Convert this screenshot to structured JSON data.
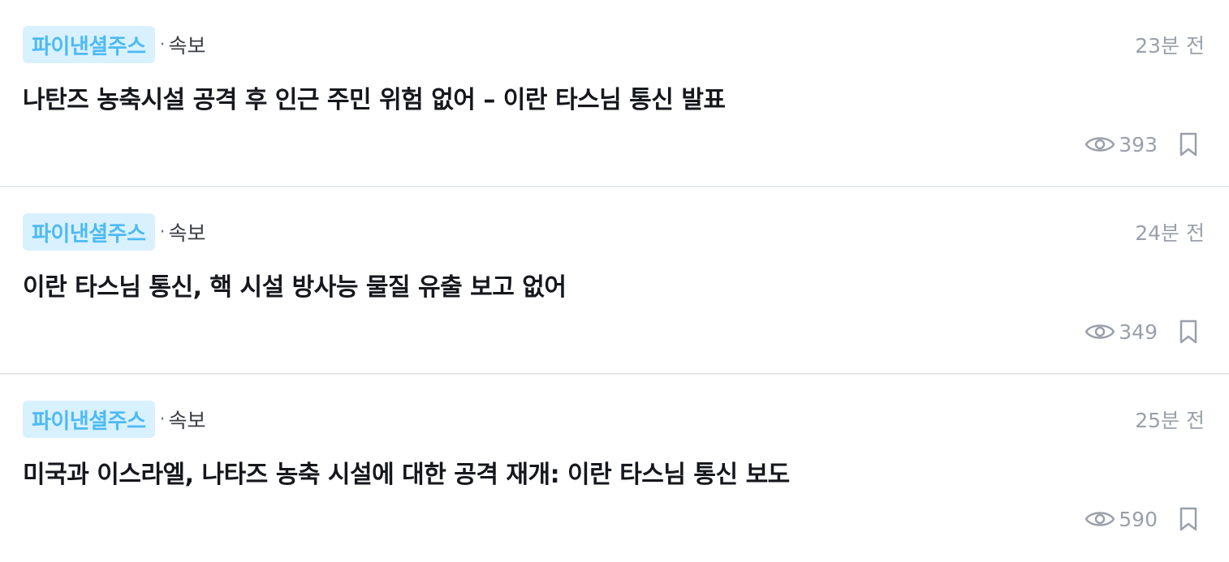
{
  "news": [
    {
      "source": "파이낸셜주스",
      "separator": "·",
      "category": "속보",
      "time": "23분 전",
      "headline": "나탄즈 농축시설 공격 후 인근 주민 위험 없어 – 이란 타스님 통신 발표",
      "views": "393"
    },
    {
      "source": "파이낸셜주스",
      "separator": "·",
      "category": "속보",
      "time": "24분 전",
      "headline": "이란 타스님 통신, 핵 시설 방사능 물질 유출 보고 없어",
      "views": "349"
    },
    {
      "source": "파이낸셜주스",
      "separator": "·",
      "category": "속보",
      "time": "25분 전",
      "headline": "미국과 이스라엘, 나타즈 농축 시설에 대한 공격 재개: 이란 타스님 통신 보도",
      "views": "590"
    }
  ],
  "colors": {
    "badge_bg": "#d9f1ff",
    "badge_text": "#4dbaf4",
    "headline": "#15171c",
    "muted": "#9aa0ab",
    "divider": "#e6e8ee"
  },
  "icons": {
    "views": "eye-icon",
    "bookmark": "bookmark-icon"
  }
}
